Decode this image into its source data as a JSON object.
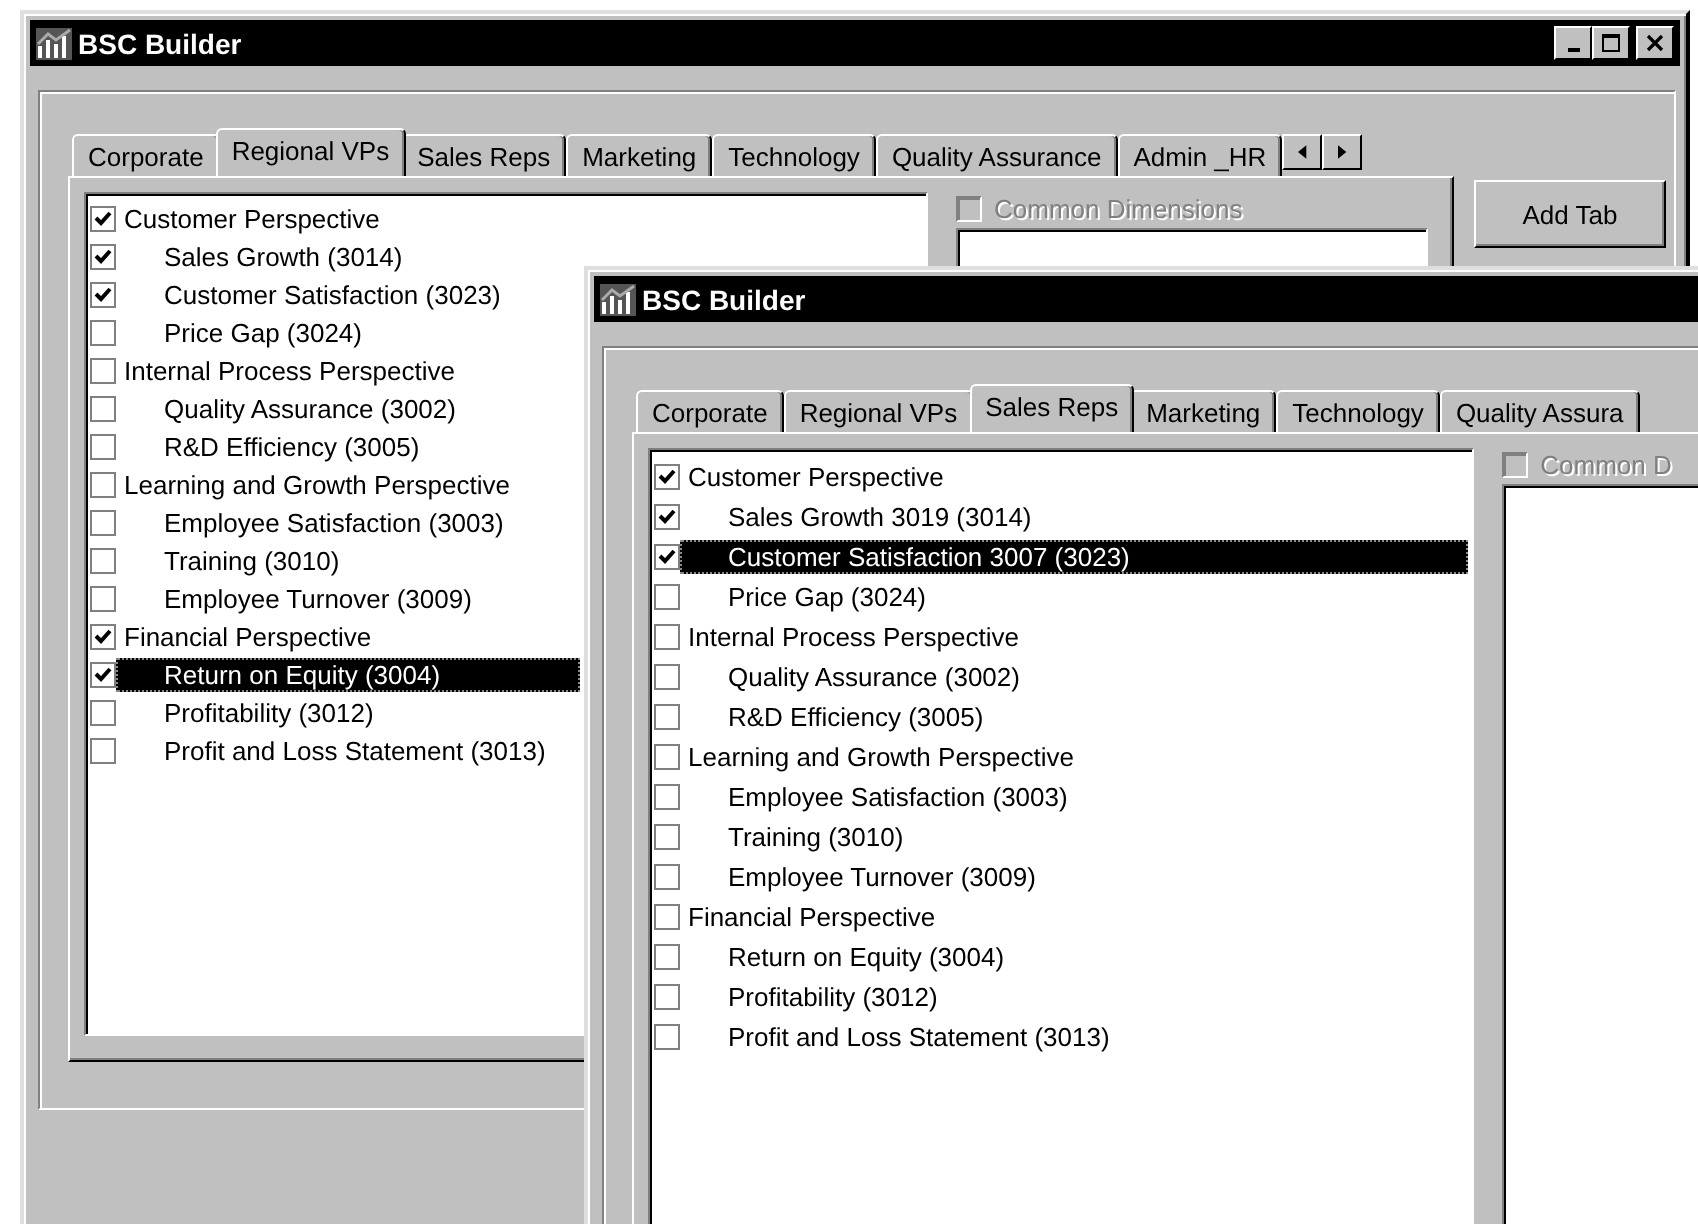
{
  "windows": [
    {
      "title": "BSC Builder",
      "window_buttons": true,
      "tabs": [
        {
          "label": "Corporate",
          "selected": false
        },
        {
          "label": "Regional VPs",
          "selected": true
        },
        {
          "label": "Sales Reps",
          "selected": false
        },
        {
          "label": "Marketing",
          "selected": false
        },
        {
          "label": "Technology",
          "selected": false
        },
        {
          "label": "Quality Assurance",
          "selected": false
        },
        {
          "label": "Admin _HR",
          "selected": false
        }
      ],
      "tab_scroller": true,
      "tree": [
        {
          "label": "Customer Perspective",
          "checked": true,
          "selected": false,
          "children": [
            {
              "label": "Sales Growth (3014)",
              "checked": true,
              "selected": false
            },
            {
              "label": "Customer Satisfaction (3023)",
              "checked": true,
              "selected": false
            },
            {
              "label": "Price Gap (3024)",
              "checked": false,
              "selected": false
            }
          ]
        },
        {
          "label": "Internal Process Perspective",
          "checked": false,
          "selected": false,
          "children": [
            {
              "label": "Quality Assurance (3002)",
              "checked": false,
              "selected": false
            },
            {
              "label": "R&D Efficiency (3005)",
              "checked": false,
              "selected": false
            }
          ]
        },
        {
          "label": "Learning and Growth Perspective",
          "checked": false,
          "selected": false,
          "children": [
            {
              "label": "Employee Satisfaction (3003)",
              "checked": false,
              "selected": false
            },
            {
              "label": "Training (3010)",
              "checked": false,
              "selected": false
            },
            {
              "label": "Employee Turnover (3009)",
              "checked": false,
              "selected": false
            }
          ]
        },
        {
          "label": "Financial Perspective",
          "checked": true,
          "selected": false,
          "children": [
            {
              "label": "Return on Equity (3004)",
              "checked": true,
              "selected": true
            },
            {
              "label": "Profitability (3012)",
              "checked": false,
              "selected": false
            },
            {
              "label": "Profit and Loss Statement (3013)",
              "checked": false,
              "selected": false
            }
          ]
        }
      ],
      "common_dimensions": {
        "label": "Common Dimensions",
        "checked": false,
        "disabled": true
      },
      "add_tab_button": "Add Tab"
    },
    {
      "title": "BSC Builder",
      "window_buttons": false,
      "tabs": [
        {
          "label": "Corporate",
          "selected": false
        },
        {
          "label": "Regional VPs",
          "selected": false
        },
        {
          "label": "Sales Reps",
          "selected": true
        },
        {
          "label": "Marketing",
          "selected": false
        },
        {
          "label": "Technology",
          "selected": false
        },
        {
          "label": "Quality Assura",
          "selected": false
        }
      ],
      "tab_scroller": false,
      "tree": [
        {
          "label": "Customer Perspective",
          "checked": true,
          "selected": false,
          "children": [
            {
              "label": "Sales Growth 3019 (3014)",
              "checked": true,
              "selected": false
            },
            {
              "label": "Customer Satisfaction 3007 (3023)",
              "checked": true,
              "selected": true
            },
            {
              "label": "Price Gap (3024)",
              "checked": false,
              "selected": false
            }
          ]
        },
        {
          "label": "Internal Process Perspective",
          "checked": false,
          "selected": false,
          "children": [
            {
              "label": "Quality Assurance (3002)",
              "checked": false,
              "selected": false
            },
            {
              "label": "R&D Efficiency (3005)",
              "checked": false,
              "selected": false
            }
          ]
        },
        {
          "label": "Learning and Growth Perspective",
          "checked": false,
          "selected": false,
          "children": [
            {
              "label": "Employee Satisfaction (3003)",
              "checked": false,
              "selected": false
            },
            {
              "label": "Training (3010)",
              "checked": false,
              "selected": false
            },
            {
              "label": "Employee Turnover (3009)",
              "checked": false,
              "selected": false
            }
          ]
        },
        {
          "label": "Financial Perspective",
          "checked": false,
          "selected": false,
          "children": [
            {
              "label": "Return on Equity (3004)",
              "checked": false,
              "selected": false
            },
            {
              "label": "Profitability (3012)",
              "checked": false,
              "selected": false
            },
            {
              "label": "Profit and Loss Statement (3013)",
              "checked": false,
              "selected": false
            }
          ]
        }
      ],
      "common_dimensions": {
        "label": "Common D",
        "checked": false,
        "disabled": true
      }
    }
  ]
}
